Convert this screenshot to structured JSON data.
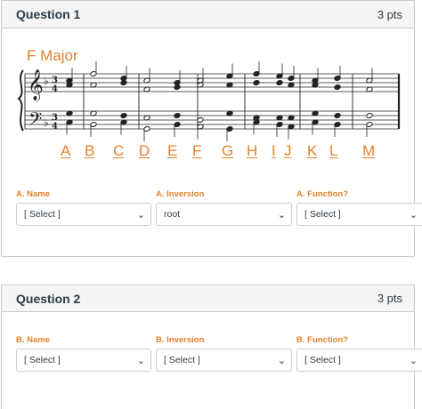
{
  "question1": {
    "title": "Question 1",
    "points": "3 pts",
    "key_label": "F Major",
    "chord_letters": [
      "A",
      "B",
      "C",
      "D",
      "E",
      "F",
      "G",
      "H",
      "I",
      "J",
      "K",
      "L",
      "M"
    ],
    "fields": [
      {
        "label": "A. Name",
        "value": "[ Select ]"
      },
      {
        "label": "A. Inversion",
        "value": "root"
      },
      {
        "label": "A. Function?",
        "value": "[ Select ]"
      }
    ]
  },
  "question2": {
    "title": "Question 2",
    "points": "3 pts",
    "fields": [
      {
        "label": "B. Name",
        "value": "[ Select ]"
      },
      {
        "label": "B. Inversion",
        "value": "[ Select ]"
      },
      {
        "label": "B. Function?",
        "value": "[ Select ]"
      }
    ]
  },
  "score": {
    "clefs": [
      "treble-clef",
      "bass-clef"
    ],
    "key_signature": "one flat",
    "time_signature": "3/4"
  },
  "colors": {
    "accent": "#e4812a",
    "border": "#c7cdd1",
    "header_bg": "#f5f5f5",
    "text": "#2d3b45"
  },
  "icons": [
    "chevron-down-icon"
  ]
}
